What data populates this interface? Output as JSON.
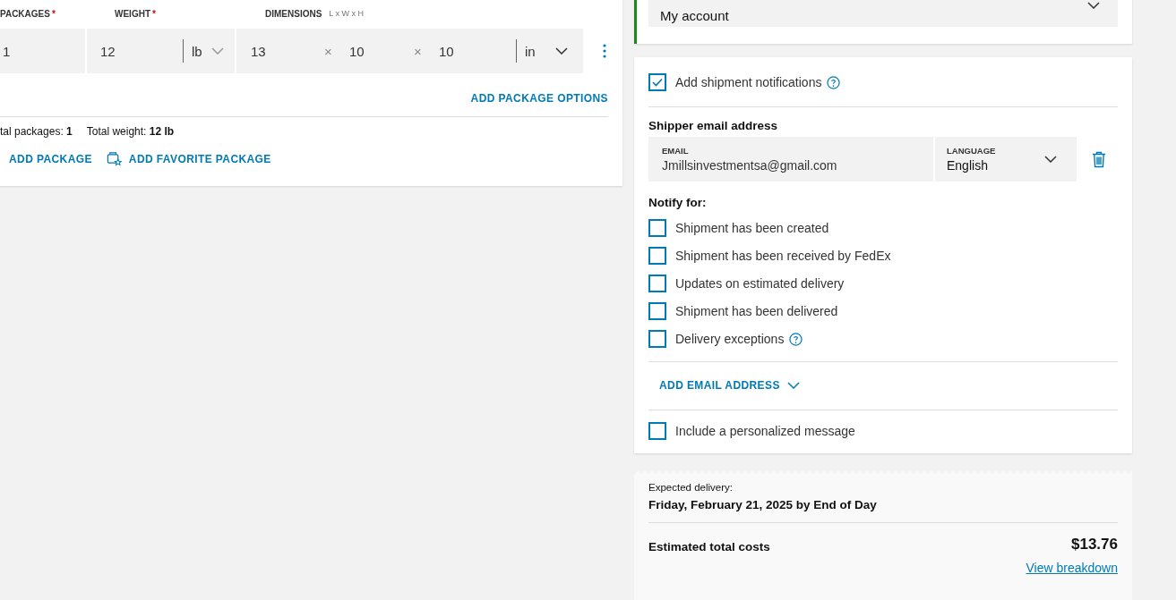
{
  "package_form": {
    "packages": {
      "label": "PACKAGES",
      "required_mark": "*",
      "value": "1"
    },
    "weight": {
      "label": "WEIGHT",
      "required_mark": "*",
      "value": "12",
      "unit": "lb"
    },
    "dimensions": {
      "label": "DIMENSIONS",
      "hint": "L x W x H",
      "unit": "in",
      "values": [
        {
          "value": "13"
        },
        {
          "separator": "×",
          "value": "10"
        },
        {
          "separator": "×",
          "value": "10"
        }
      ]
    },
    "add_options": "ADD PACKAGE OPTIONS",
    "totals": [
      "tal packages: **1**",
      "Total weight: **12 lb**"
    ],
    "actions": [
      {
        "kind": "plain",
        "label": "ADD PACKAGE"
      },
      {
        "kind": "favorite",
        "label": "ADD FAVORITE PACKAGE"
      }
    ]
  },
  "billing": {
    "value": "My account"
  },
  "notifications": {
    "enable": {
      "label": "Add shipment notifications",
      "checked": true,
      "help": true
    },
    "email_title": "Shipper email address",
    "email": {
      "label": "EMAIL",
      "value": "Jmillsinvestmentsa@gmail.com"
    },
    "language": {
      "label": "LANGUAGE",
      "value": "English"
    },
    "notify_title": "Notify for:",
    "options": [
      {
        "label": "Shipment has been created",
        "checked": false,
        "help": false
      },
      {
        "label": "Shipment has been received by FedEx",
        "checked": false,
        "help": false
      },
      {
        "label": "Updates on estimated delivery",
        "checked": false,
        "help": false
      },
      {
        "label": "Shipment has been delivered",
        "checked": false,
        "help": false
      },
      {
        "label": "Delivery exceptions",
        "checked": false,
        "help": true
      }
    ],
    "add_email": "ADD EMAIL ADDRESS",
    "personal": {
      "label": "Include a personalized message",
      "checked": false,
      "help": false
    }
  },
  "summary": {
    "delivery_label": "Expected delivery:",
    "delivery_date": "Friday, February 21, 2025 by End of Day",
    "total_label": "Estimated total costs",
    "total_value": "$13.76",
    "breakdown_link": "View breakdown"
  }
}
